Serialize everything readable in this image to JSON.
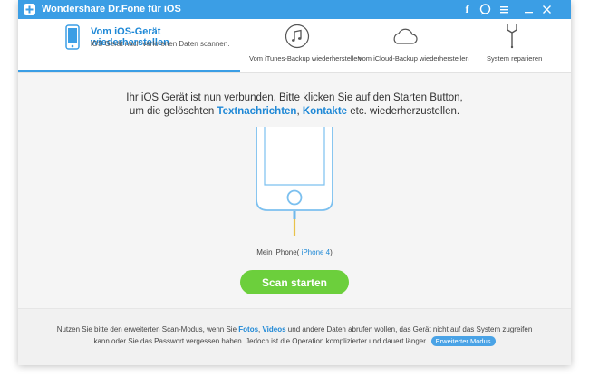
{
  "app": {
    "title": "Wondershare Dr.Fone für iOS"
  },
  "titlebar": {
    "icons": [
      "facebook-icon",
      "feedback-icon",
      "menu-icon",
      "minimize-icon",
      "close-icon"
    ]
  },
  "tabs": {
    "active": {
      "title": "Vom iOS-Gerät wiederherstellen",
      "subtitle": "iOS Gerät nach verlorenen Daten scannen."
    },
    "items": [
      {
        "label": "Vom iTunes-Backup wiederherstellen",
        "icon": "music-note-icon"
      },
      {
        "label": "Vom iCloud-Backup wiederherstellen",
        "icon": "cloud-icon"
      },
      {
        "label": "System reparieren",
        "icon": "wrench-icon"
      }
    ]
  },
  "main": {
    "line1": "Ihr iOS Gerät ist nun verbunden. Bitte klicken Sie auf den Starten Button,",
    "line2_pre": "um die gelöschten ",
    "link1": "Textnachrichten",
    "sep": ", ",
    "link2": "Kontakte",
    "line2_post": " etc. wiederherzustellen.",
    "device_prefix": "Mein iPhone(",
    "device_model": " iPhone 4",
    "device_suffix": ")",
    "scan_label": "Scan starten"
  },
  "footer": {
    "text_pre": "Nutzen Sie bitte den erweiterten Scan-Modus, wenn Sie ",
    "hl1": "Fotos",
    "sep": ", ",
    "hl2": "Videos",
    "text_mid": " und andere Daten abrufen wollen, das Gerät nicht auf das System zugreifen kann oder Sie das Passwort vergessen haben. Jedoch ist die Operation komplizierter und dauert länger.",
    "advanced_label": "Erweiterter Modus"
  },
  "colors": {
    "accent": "#3b9ee5",
    "link": "#1e88d6",
    "scan": "#6ccf3c"
  }
}
